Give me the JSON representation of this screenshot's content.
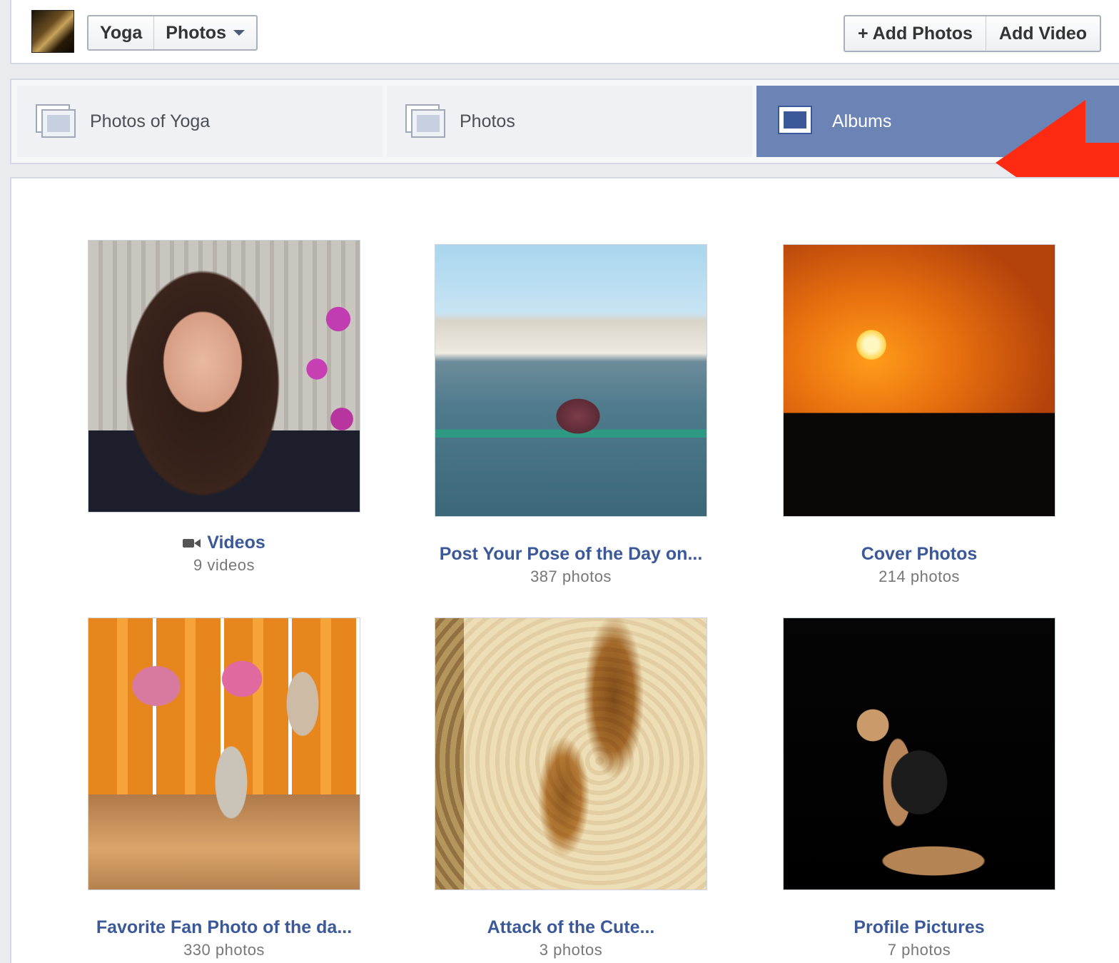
{
  "header": {
    "breadcrumb_page": "Yoga",
    "breadcrumb_section": "Photos",
    "add_photos_label": "+ Add Photos",
    "add_video_label": "Add Video"
  },
  "tabs": [
    {
      "label": "Photos of Yoga",
      "active": false
    },
    {
      "label": "Photos",
      "active": false
    },
    {
      "label": "Albums",
      "active": true
    }
  ],
  "albums": [
    {
      "title": "Videos",
      "count": "9 videos"
    },
    {
      "title": "Post Your Pose of the Day on...",
      "count": "387 photos"
    },
    {
      "title": "Cover Photos",
      "count": "214 photos"
    },
    {
      "title": "Favorite Fan Photo of the da...",
      "count": "330 photos"
    },
    {
      "title": "Attack of the Cute...",
      "count": "3 photos"
    },
    {
      "title": "Profile Pictures",
      "count": "7 photos"
    }
  ],
  "colors": {
    "link_blue": "#3b5998",
    "active_tab": "#6c84b5",
    "annotation_red": "#ff2a12"
  },
  "icons": {
    "tab_photos_of": "tagged-photos-icon",
    "tab_photos": "photos-icon",
    "tab_albums": "albums-icon",
    "videos_album": "video-camera-icon"
  }
}
